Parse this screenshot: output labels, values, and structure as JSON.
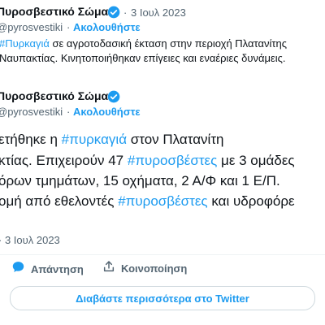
{
  "tweet1": {
    "author_name": "Πυροσβεστικό Σώμα",
    "sep": "·",
    "date": "3 Ιουλ 2023",
    "handle": "@pyrosvestiki",
    "follow": "Ακολουθήστε",
    "line1_hashtag": "#Πυρκαγιά",
    "line1_rest": " σε αγροτοδασική έκταση στην περιοχή Πλατανίτης",
    "line2": "Ναυπακτίας. Κινητοποιήθηκαν επίγειες και εναέριες δυνάμεις."
  },
  "tweet2": {
    "author_name": "Πυροσβεστικό Σώμα",
    "handle": "@pyrosvestiki",
    "follow": "Ακολουθήστε",
    "line1_a": "ετήθηκε  η ",
    "line1_hashtag": "#πυρκαγιά",
    "line1_b": " στον Πλατανίτη",
    "line2_a": "κτίας. Επιχειρούν 47 ",
    "line2_hashtag": "#πυροσβέστες",
    "line2_b": " με 3 ομάδες",
    "line3": "όρων τμημάτων, 15 οχήματα, 2 Α/Φ και 1 Ε/Π.",
    "line4_a": "ομή από εθελοντές ",
    "line4_hashtag": "#πυροσβέστες",
    "line4_b": " και υδροφόρε",
    "date": "3 Ιουλ 2023"
  },
  "actions": {
    "reply": "Απάντηση",
    "share": "Κοινοποίηση"
  },
  "read_more": "Διαβάστε περισσότερα στο Twitter",
  "colors": {
    "link": "#1d9bf0",
    "verified": "#1d9bf0",
    "reply_icon": "#1d9bf0",
    "text": "#0f1419",
    "muted": "#536471"
  },
  "icons": {
    "verified": "verified-badge-icon",
    "reply": "reply-bubble-icon",
    "share": "share-upload-icon"
  }
}
